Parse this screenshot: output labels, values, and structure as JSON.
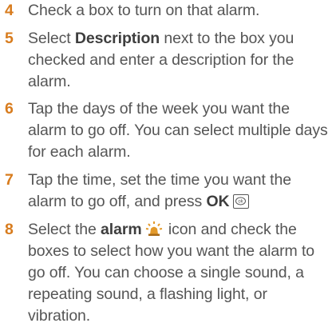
{
  "steps": [
    {
      "number": "4",
      "text": "Check a box to turn on that alarm."
    },
    {
      "number": "5",
      "before": "Select ",
      "bold": "Description",
      "after": " next to the box you checked and enter a description for the alarm."
    },
    {
      "number": "6",
      "text": "Tap the days of the week you want the alarm to go off. You can select multiple days for each alarm."
    },
    {
      "number": "7",
      "before": "Tap the time, set the time you want the alarm to go off, and press ",
      "bold": "OK",
      "after": "",
      "key_icon": "ok-key-icon"
    },
    {
      "number": "8",
      "before": "Select the ",
      "bold": "alarm",
      "icon": "alarm-siren-icon",
      "after": " icon and check the boxes to select how you want the alarm to go off. You can choose a single sound, a repeating sound, a flashing light, or vibration."
    }
  ],
  "colors": {
    "step_number": "#d87c1e",
    "body_text": "#555555",
    "alarm_icon": "#e39a2b"
  }
}
